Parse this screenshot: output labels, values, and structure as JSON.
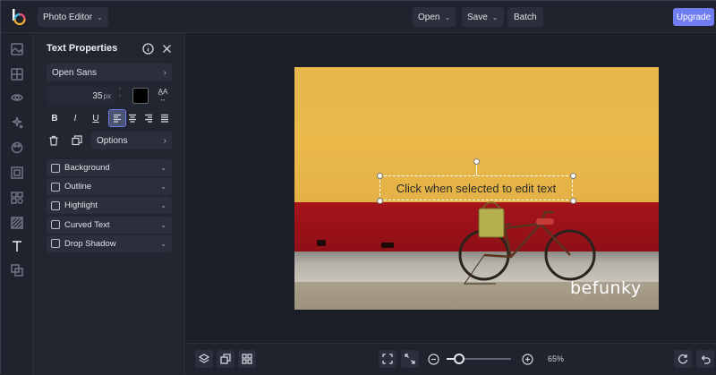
{
  "topbar": {
    "app_menu": "Photo Editor",
    "open": "Open",
    "save": "Save",
    "batch": "Batch",
    "upgrade": "Upgrade"
  },
  "panel": {
    "title": "Text Properties",
    "font": "Open Sans",
    "size_value": "35",
    "size_unit": "px",
    "text_color": "#000000",
    "bold": "B",
    "italic": "I",
    "underline": "U",
    "options": "Options",
    "sections": [
      {
        "label": "Background",
        "checked": false
      },
      {
        "label": "Outline",
        "checked": false
      },
      {
        "label": "Highlight",
        "checked": false
      },
      {
        "label": "Curved Text",
        "checked": false
      },
      {
        "label": "Drop Shadow",
        "checked": false
      }
    ]
  },
  "canvas": {
    "text": "Click when selected to edit text",
    "watermark": "befunky"
  },
  "bottombar": {
    "zoom_label": "65%",
    "zoom_level": 0.2
  },
  "colors": {
    "accent": "#6f7df1",
    "background": "#1b1e27",
    "panel": "#222631"
  }
}
